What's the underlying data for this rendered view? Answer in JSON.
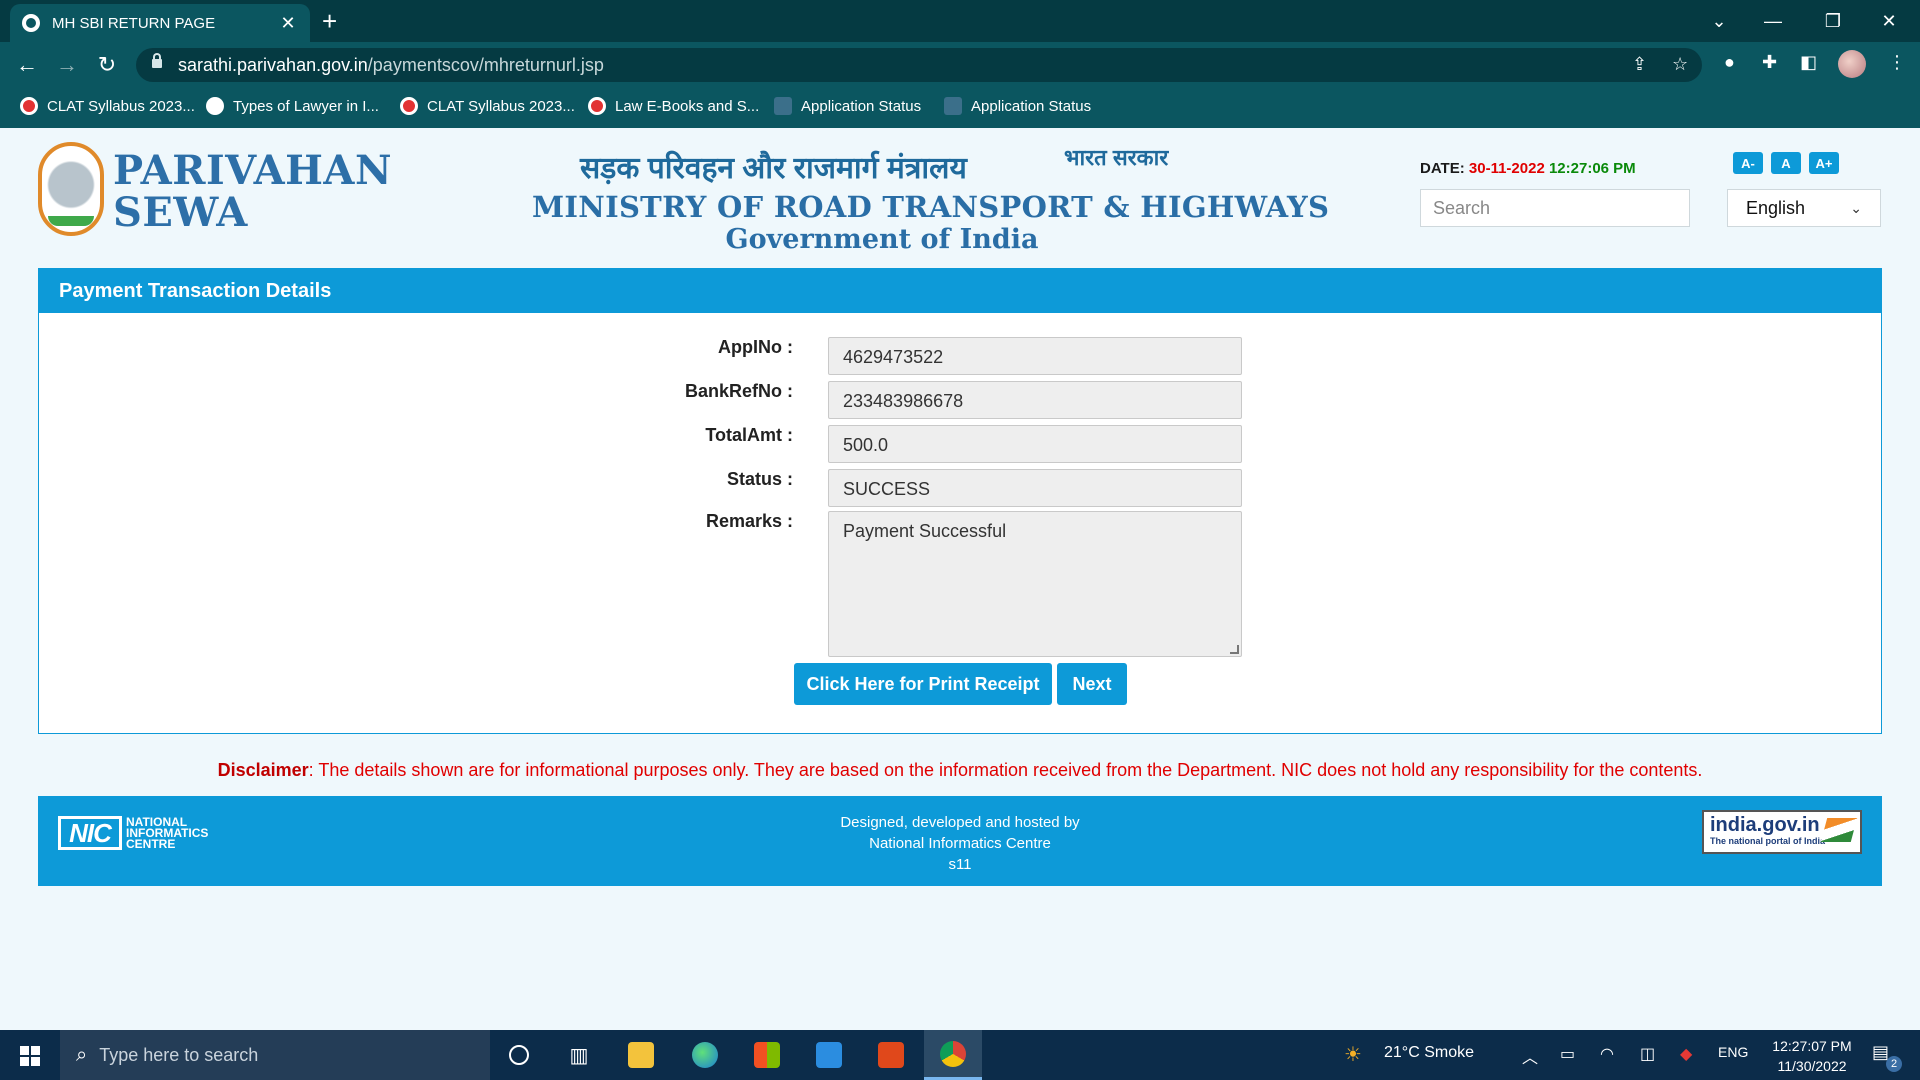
{
  "browser": {
    "tab_title": "MH SBI RETURN PAGE",
    "url_host": "sarathi.parivahan.gov.in",
    "url_path": "/paymentscov/mhreturnurl.jsp",
    "bookmarks": [
      {
        "label": "CLAT Syllabus 2023...",
        "icon": "red-circle-icon"
      },
      {
        "label": "Types of Lawyer in I...",
        "icon": "white-circle-icon"
      },
      {
        "label": "CLAT Syllabus 2023...",
        "icon": "red-circle-icon"
      },
      {
        "label": "Law E-Books and S...",
        "icon": "red-circle-icon"
      },
      {
        "label": "Application Status",
        "icon": "grid-icon"
      },
      {
        "label": "Application Status",
        "icon": "grid-icon"
      }
    ]
  },
  "header": {
    "brand_line1": "PARIVAHAN",
    "brand_line2": "SEWA",
    "hindi_title": "सड़क परिवहन और राजमार्ग मंत्रालय",
    "hindi_sub": "भारत सरकार",
    "ministry": "MINISTRY OF ROAD TRANSPORT & HIGHWAYS",
    "government": "Government of India",
    "date_label": "DATE:",
    "date_value": "30-11-2022",
    "time_value": "12:27:06 PM",
    "font_buttons": [
      "A-",
      "A",
      "A+"
    ],
    "search_placeholder": "Search",
    "language": "English"
  },
  "panel": {
    "title": "Payment Transaction Details",
    "fields": [
      {
        "label": "AppINo :",
        "value": "4629473522"
      },
      {
        "label": "BankRefNo :",
        "value": "233483986678"
      },
      {
        "label": "TotalAmt :",
        "value": "500.0"
      },
      {
        "label": "Status :",
        "value": "SUCCESS"
      },
      {
        "label": "Remarks :",
        "value": "Payment Successful"
      }
    ],
    "print_button": "Click Here for Print Receipt",
    "next_button": "Next"
  },
  "disclaimer": {
    "label": "Disclaimer",
    "text": ": The details shown are for informational purposes only. They are based on the information received from the Department. NIC does not hold any responsibility for the contents."
  },
  "footer": {
    "nic_mark": "NIC",
    "nic_line1": "NATIONAL",
    "nic_line2": "INFORMATICS",
    "nic_line3": "CENTRE",
    "line1": "Designed, developed and hosted by",
    "line2": "National Informatics Centre",
    "line3": "s11",
    "india_big": "india.gov.in",
    "india_small": "The national portal of India"
  },
  "taskbar": {
    "search_placeholder": "Type here to search",
    "weather": "21°C  Smoke",
    "language": "ENG",
    "clock_time": "12:27:07 PM",
    "clock_date": "11/30/2022",
    "notification_count": "2"
  },
  "colors": {
    "accent": "#0d9ad8",
    "chrome_dark": "#053a42",
    "chrome_toolbar": "#0b5660",
    "date_red": "#e00000",
    "time_green": "#0a8a0a"
  }
}
